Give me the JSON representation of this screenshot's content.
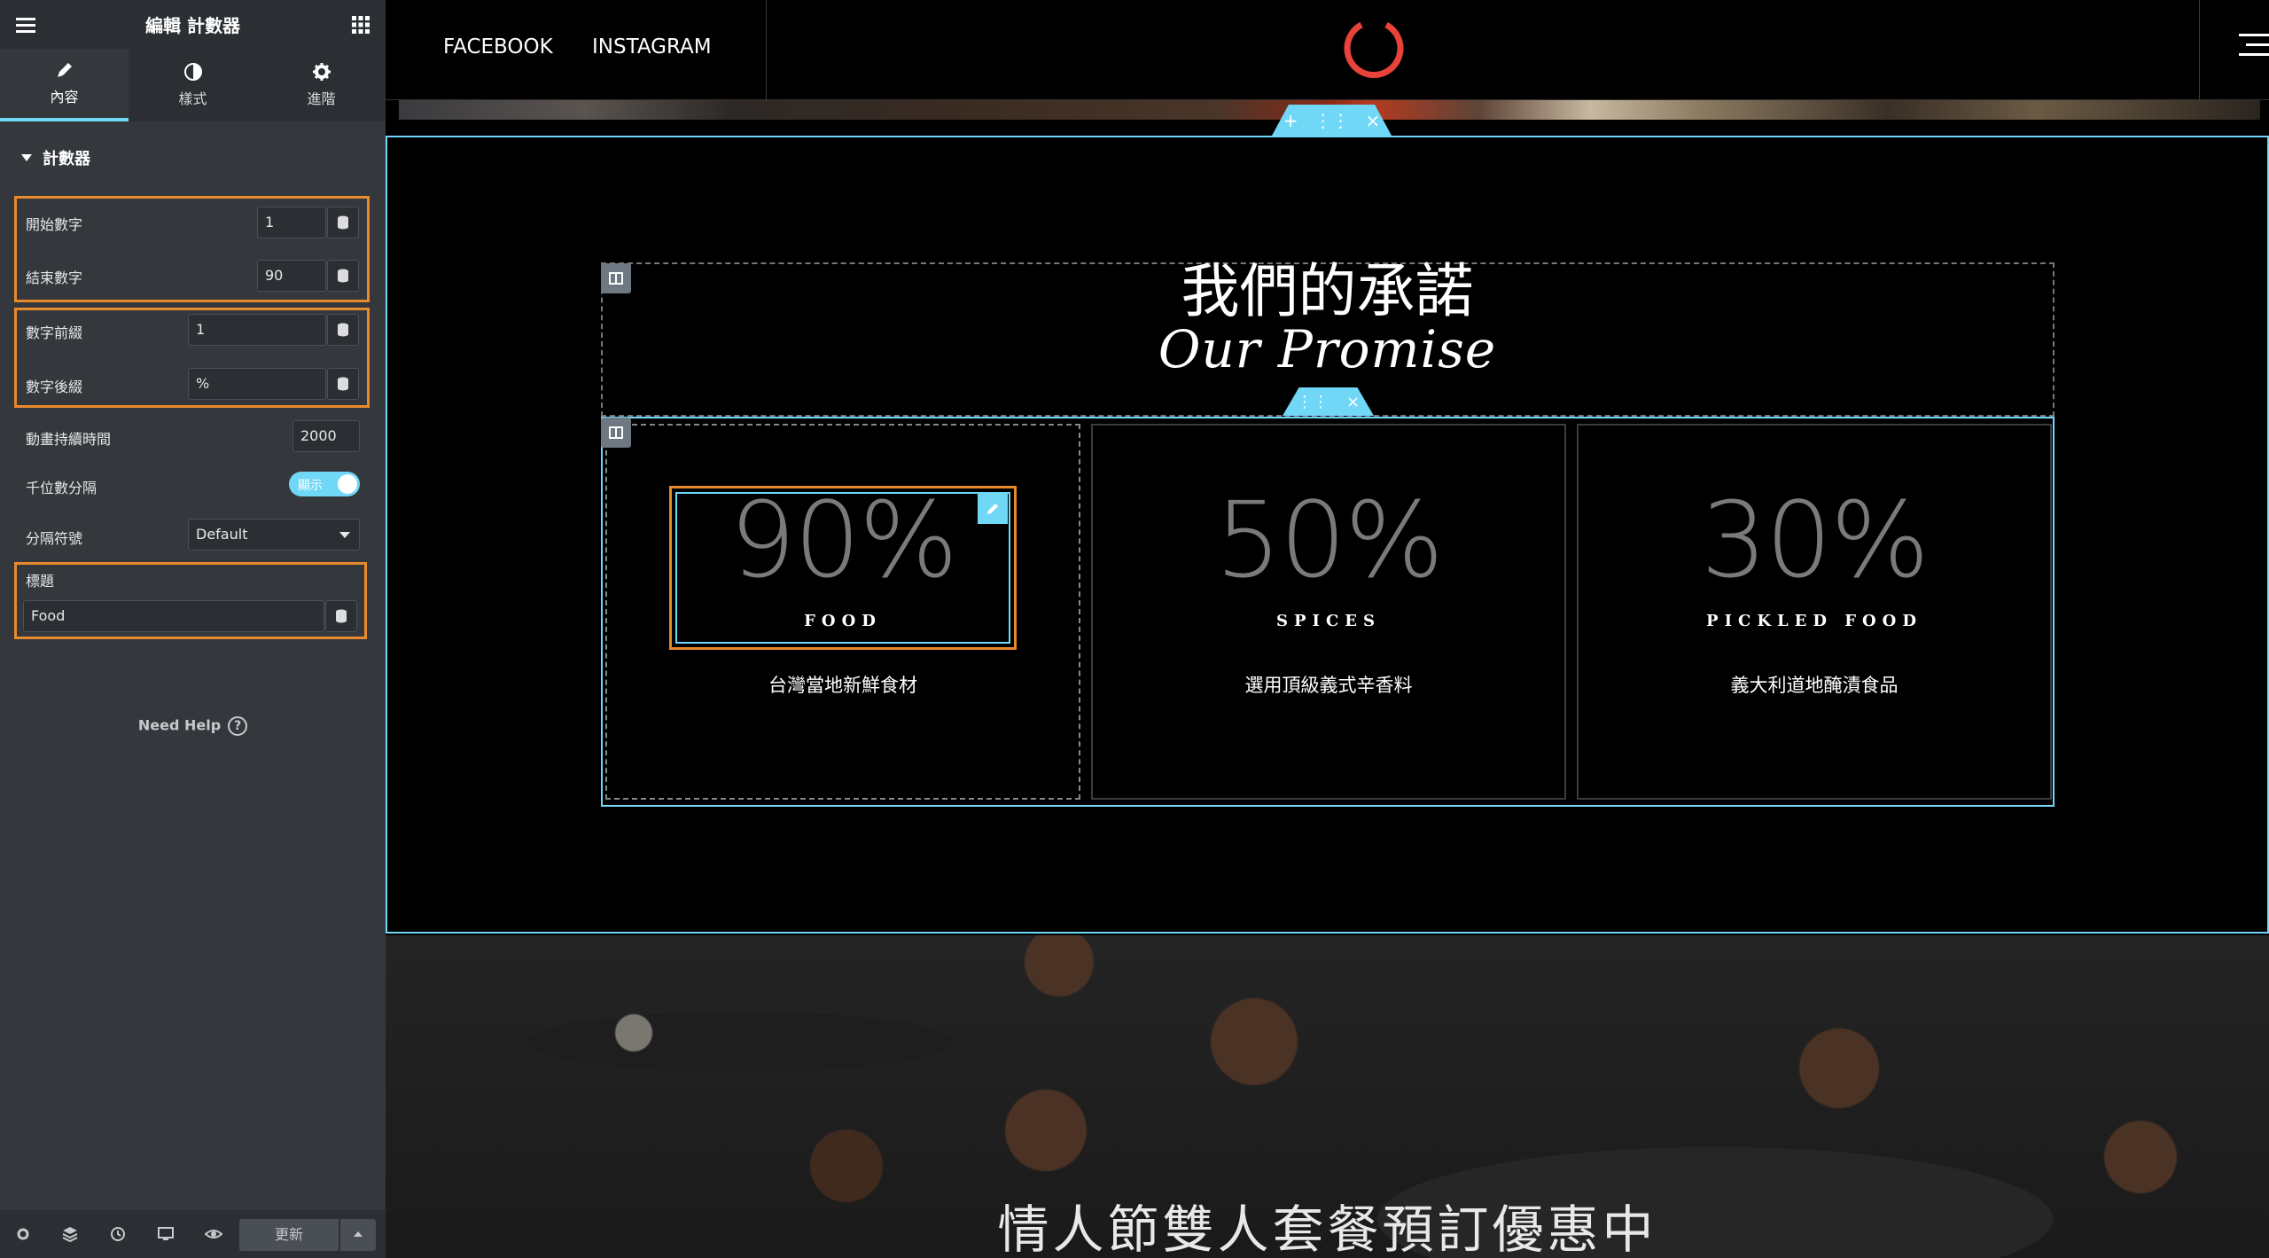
{
  "panel": {
    "title": "編輯 計數器",
    "tabs": [
      {
        "label": "內容",
        "icon": "pencil-icon"
      },
      {
        "label": "樣式",
        "icon": "half-circle-icon"
      },
      {
        "label": "進階",
        "icon": "gear-icon"
      }
    ],
    "section_title": "計數器",
    "controls": {
      "start_label": "開始數字",
      "start_value": "1",
      "end_label": "結束數字",
      "end_value": "90",
      "prefix_label": "數字前綴",
      "prefix_value": "1",
      "suffix_label": "數字後綴",
      "suffix_value": "%",
      "duration_label": "動畫持續時間",
      "duration_value": "2000",
      "thousand_label": "千位數分隔",
      "thousand_toggle": "顯示",
      "separator_label": "分隔符號",
      "separator_value": "Default",
      "title_label": "標題",
      "title_value": "Food"
    },
    "help": "Need Help",
    "update_button": "更新"
  },
  "site": {
    "nav": [
      "FACEBOOK",
      "INSTAGRAM"
    ],
    "logo_color": "#e8433a",
    "heading": "我們的承諾",
    "script_heading": "Our Promise",
    "counters": [
      {
        "number": "90%",
        "title": "FOOD",
        "desc": "台灣當地新鮮食材"
      },
      {
        "number": "50%",
        "title": "SPICES",
        "desc": "選用頂級義式辛香料"
      },
      {
        "number": "30%",
        "title": "PICKLED FOOD",
        "desc": "義大利道地醃漬食品"
      }
    ],
    "promo": "情人節雙人套餐預訂優惠中"
  },
  "colors": {
    "accent": "#71d7f7",
    "highlight": "#e8892c",
    "panel_bg": "#34383c"
  }
}
